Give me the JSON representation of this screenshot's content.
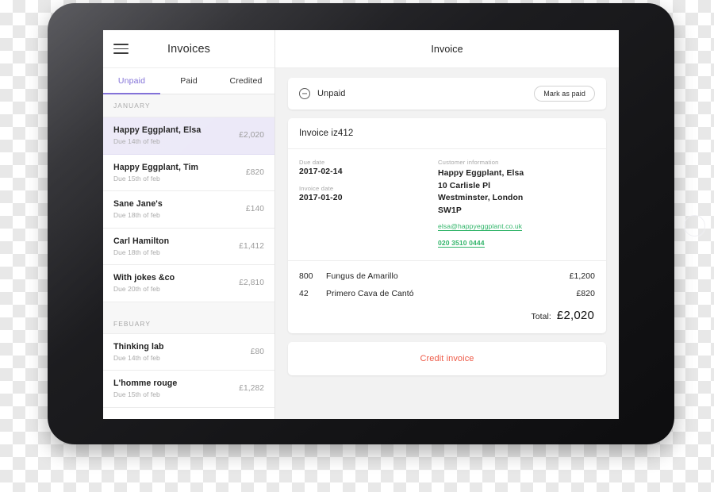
{
  "sidebar": {
    "menu_icon": "hamburger-icon",
    "title": "Invoices",
    "tabs": [
      {
        "label": "Unpaid",
        "active": true
      },
      {
        "label": "Paid",
        "active": false
      },
      {
        "label": "Credited",
        "active": false
      }
    ],
    "groups": [
      {
        "month": "JANUARY",
        "invoices": [
          {
            "name": "Happy Eggplant, Elsa",
            "due": "Due 14th of feb",
            "amount": "£2,020",
            "selected": true
          },
          {
            "name": "Happy Eggplant, Tim",
            "due": "Due 15th of feb",
            "amount": "£820",
            "selected": false
          },
          {
            "name": "Sane Jane's",
            "due": "Due 18th of feb",
            "amount": "£140",
            "selected": false
          },
          {
            "name": "Carl Hamilton",
            "due": "Due 18th of feb",
            "amount": "£1,412",
            "selected": false
          },
          {
            "name": "With jokes &co",
            "due": "Due 20th of feb",
            "amount": "£2,810",
            "selected": false
          }
        ]
      },
      {
        "month": "FEBUARY",
        "invoices": [
          {
            "name": "Thinking lab",
            "due": "Due 14th of feb",
            "amount": "£80",
            "selected": false
          },
          {
            "name": "L'homme rouge",
            "due": "Due 15th of feb",
            "amount": "£1,282",
            "selected": false
          }
        ]
      }
    ]
  },
  "detail": {
    "title": "Invoice",
    "status": {
      "icon": "circle-minus-icon",
      "label": "Unpaid",
      "action_label": "Mark as paid"
    },
    "invoice_id": "Invoice iz412",
    "meta": {
      "due_date_label": "Due date",
      "due_date_value": "2017-02-14",
      "invoice_date_label": "Invoice date",
      "invoice_date_value": "2017-01-20",
      "customer_label": "Customer information",
      "customer_name": "Happy Eggplant, Elsa",
      "customer_address_1": "10 Carlisle Pl",
      "customer_address_2": "Westminster, London",
      "customer_postcode": "SW1P",
      "customer_email": "elsa@happyeggplant.co.uk",
      "customer_phone": "020 3510 0444"
    },
    "line_items": [
      {
        "qty": "800",
        "description": "Fungus de Amarillo",
        "price": "£1,200"
      },
      {
        "qty": "42",
        "description": "Primero Cava de Cantó",
        "price": "£820"
      }
    ],
    "total_label": "Total:",
    "total_value": "£2,020",
    "credit_label": "Credit invoice"
  },
  "colors": {
    "accent_purple": "#7c6ad6",
    "selected_row": "#ece9f8",
    "link_green": "#32b56a",
    "credit_red": "#ee5a47",
    "device_dark": "#151518"
  }
}
